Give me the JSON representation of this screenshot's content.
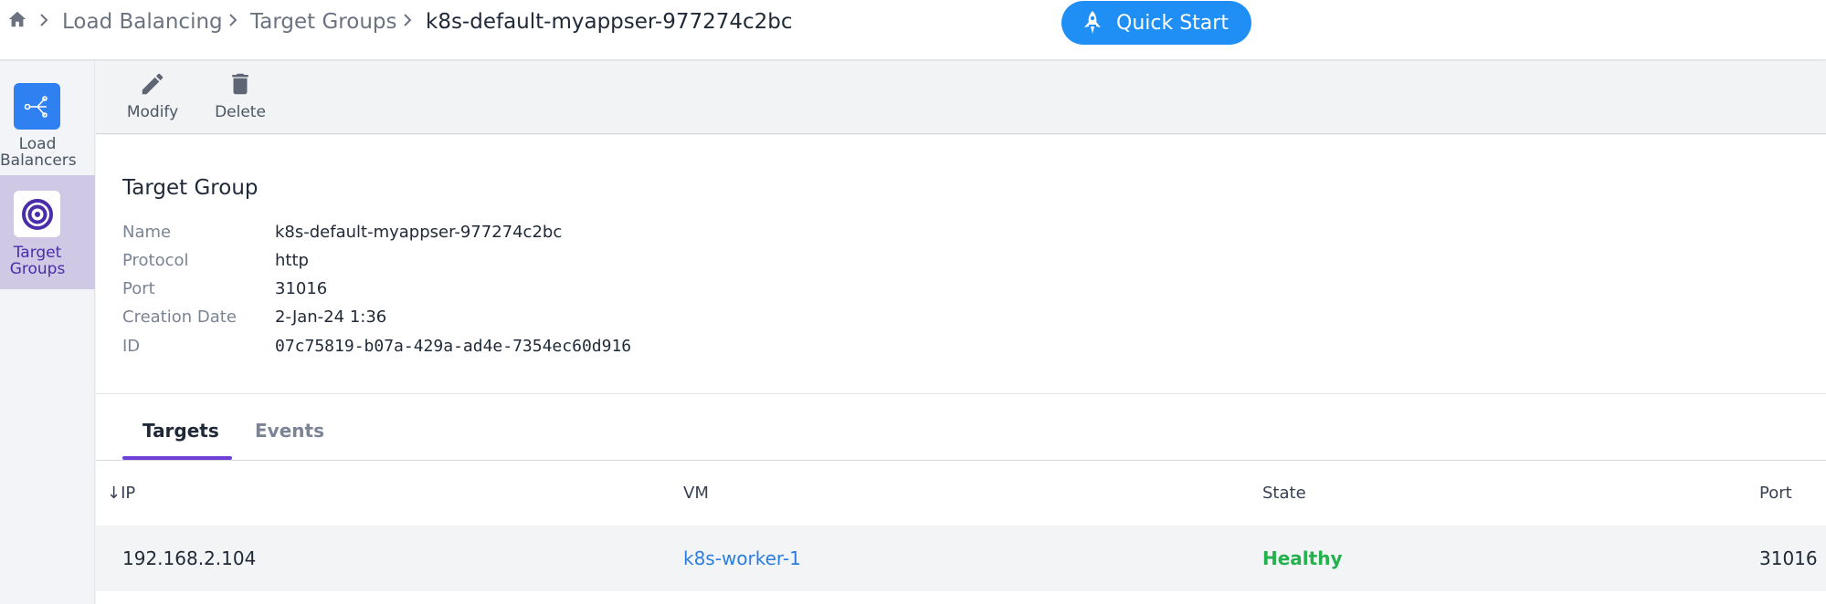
{
  "breadcrumb": {
    "items": [
      {
        "label": "Load Balancing"
      },
      {
        "label": "Target Groups"
      },
      {
        "label": "k8s-default-myappser-977274c2bc"
      }
    ]
  },
  "quick_start": {
    "label": "Quick Start"
  },
  "sidebar": {
    "items": [
      {
        "label_line1": "Load",
        "label_line2": "Balancers",
        "active": false
      },
      {
        "label_line1": "Target",
        "label_line2": "Groups",
        "active": true
      }
    ]
  },
  "toolbar": {
    "modify_label": "Modify",
    "delete_label": "Delete"
  },
  "target_group": {
    "title": "Target Group",
    "fields": [
      {
        "label": "Name",
        "value": "k8s-default-myappser-977274c2bc"
      },
      {
        "label": "Protocol",
        "value": "http"
      },
      {
        "label": "Port",
        "value": "31016"
      },
      {
        "label": "Creation Date",
        "value": "2-Jan-24 1:36"
      },
      {
        "label": "ID",
        "value": "07c75819-b07a-429a-ad4e-7354ec60d916"
      }
    ]
  },
  "tabs": [
    {
      "label": "Targets",
      "active": true
    },
    {
      "label": "Events",
      "active": false
    }
  ],
  "table": {
    "sort_indicator": "↓",
    "columns": [
      "IP",
      "VM",
      "State",
      "Port"
    ],
    "rows": [
      {
        "ip": "192.168.2.104",
        "vm": "k8s-worker-1",
        "state": "Healthy",
        "port": "31016"
      }
    ]
  },
  "colors": {
    "accent": "#1f8ff5",
    "tab_underline": "#6d3fd6",
    "healthy": "#22b14c",
    "link": "#2b7de0",
    "sidebar_active": "#cfc9e6"
  }
}
